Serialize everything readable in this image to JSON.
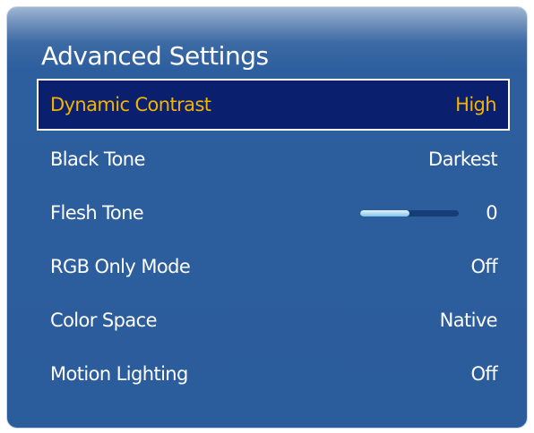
{
  "screen": {
    "title": "Advanced Settings"
  },
  "menu": {
    "items": [
      {
        "label": "Dynamic Contrast",
        "value": "High",
        "focused": true
      },
      {
        "label": "Black Tone",
        "value": "Darkest"
      },
      {
        "label": "Flesh Tone",
        "value": "0",
        "slider_level": 0.5
      },
      {
        "label": "RGB Only Mode",
        "value": "Off"
      },
      {
        "label": "Color Space",
        "value": "Native"
      },
      {
        "label": "Motion Lighting",
        "value": "Off"
      }
    ]
  },
  "colors": {
    "panel_background": "#2b5c9c",
    "focus_background": "#0a1f6d",
    "focus_text": "#f2b400",
    "text": "#ffffff"
  }
}
